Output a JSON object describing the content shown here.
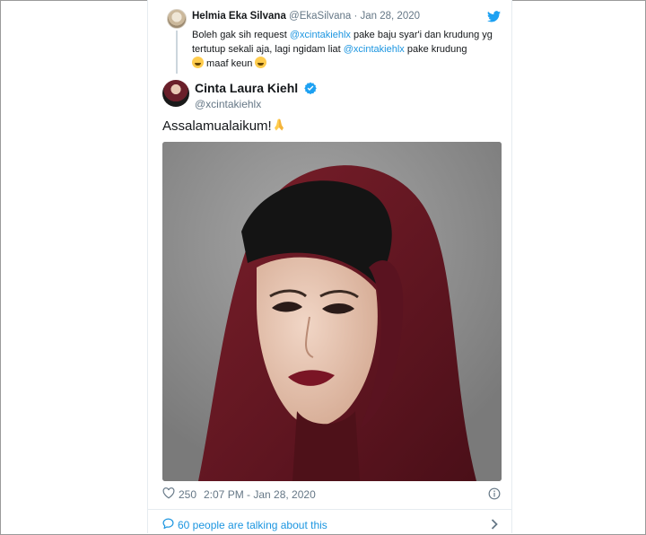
{
  "reply": {
    "name": "Helmia Eka Silvana",
    "handle": "@EkaSilvana",
    "date": "Jan 28, 2020",
    "text_1": "Boleh gak sih request ",
    "mention_1": "@xcintakiehlx",
    "text_2": " pake baju syar'i dan krudung yg tertutup sekali aja, lagi ngidam liat ",
    "mention_2": "@xcintakiehlx",
    "text_3": " pake krudung",
    "text_4": " maaf keun "
  },
  "tweet": {
    "name": "Cinta Laura Kiehl",
    "handle": "@xcintakiehlx",
    "text": "Assalamualaikum!"
  },
  "footer": {
    "likes": "250",
    "time": "2:07 PM - Jan 28, 2020",
    "talking": "60 people are talking about this"
  },
  "colors": {
    "link": "#1b95e0",
    "muted": "#657786",
    "verified": "#1da1f2",
    "hijab": "#6e1a24"
  }
}
